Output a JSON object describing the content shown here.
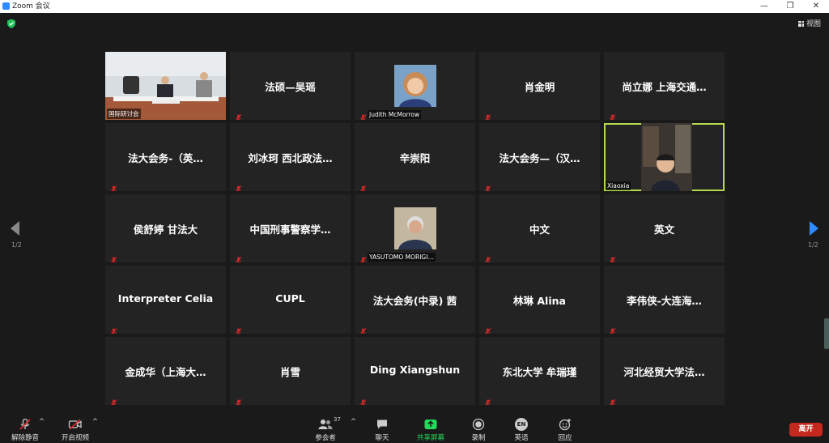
{
  "window": {
    "title": "Zoom 会议",
    "min": "—",
    "max": "❐",
    "close": "✕"
  },
  "view_button": "视图",
  "pager": {
    "left": "1/2",
    "right": "1/2"
  },
  "tiles": [
    {
      "name": "",
      "label": "国际研讨会",
      "type": "video-room"
    },
    {
      "name": "法硕—吴瑶"
    },
    {
      "name": "",
      "label": "Judith McMorrow",
      "type": "photo-woman"
    },
    {
      "name": "肖金明"
    },
    {
      "name": "尚立娜 上海交通…"
    },
    {
      "name": "法大会务-（英…"
    },
    {
      "name": "刘冰珂 西北政法…"
    },
    {
      "name": "辛崇阳"
    },
    {
      "name": "法大会务—（汉…"
    },
    {
      "name": "",
      "label": "Xiaoxia",
      "type": "video-man",
      "active": true
    },
    {
      "name": "侯舒婷 甘法大"
    },
    {
      "name": "中国刑事警察学…"
    },
    {
      "name": "",
      "label": "YASUTOMO MORIGI…",
      "type": "photo-elder"
    },
    {
      "name": "中文"
    },
    {
      "name": "英文"
    },
    {
      "name": "Interpreter Celia"
    },
    {
      "name": "CUPL"
    },
    {
      "name": "法大会务(中录) 茜"
    },
    {
      "name": "林琳 Alina"
    },
    {
      "name": "李伟侠-大连海…"
    },
    {
      "name": "金成华（上海大…"
    },
    {
      "name": "肖雪"
    },
    {
      "name": "Ding Xiangshun"
    },
    {
      "name": "东北大学 牟瑞瑾"
    },
    {
      "name": "河北经贸大学法…"
    }
  ],
  "toolbar": {
    "mute": "解除静音",
    "video": "开启视频",
    "participants": "参会者",
    "participants_count": "37",
    "chat": "聊天",
    "share": "共享屏幕",
    "record": "录制",
    "language": "英语",
    "language_badge": "EN",
    "reactions": "回应",
    "leave": "离开",
    "caret": "^"
  },
  "colors": {
    "accent_share": "#23d959",
    "active_border": "#b5d94f",
    "leave": "#c5281c",
    "muted": "#e02828"
  }
}
